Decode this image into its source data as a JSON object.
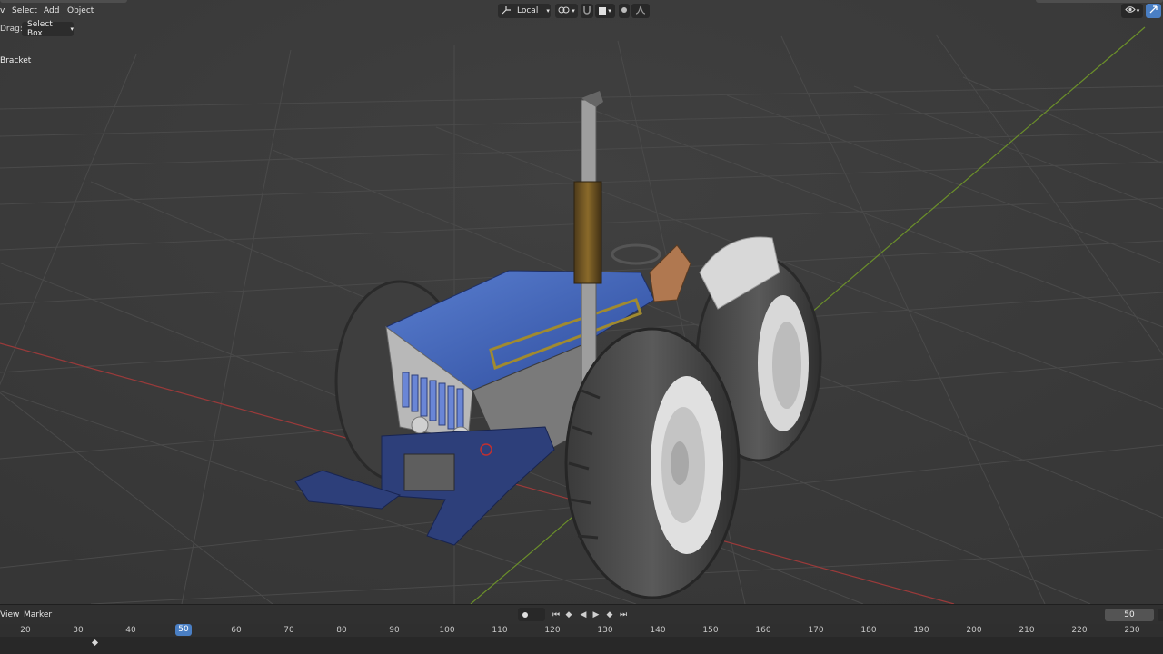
{
  "header": {
    "menu": [
      "Select",
      "Add",
      "Object"
    ],
    "transform_orientation": "Local",
    "colors": {
      "accent": "#4a7fc4",
      "viewport_bg": "#3a3a3a",
      "header_bg": "#2b2b2b"
    }
  },
  "tool_settings": {
    "drag_label": "Drag:",
    "drag_value": "Select Box"
  },
  "operator_panel": {
    "label": "Bracket"
  },
  "timeline": {
    "menu": [
      "View",
      "Marker"
    ],
    "current_frame": "50",
    "frame_field": "50",
    "ticks": [
      "20",
      "30",
      "40",
      "50",
      "60",
      "70",
      "80",
      "90",
      "100",
      "110",
      "120",
      "130",
      "140",
      "150",
      "160",
      "170",
      "180",
      "190",
      "200",
      "210",
      "220",
      "230"
    ],
    "keyframe_frames": [
      34
    ]
  },
  "icons": {
    "orientation": "axes-icon",
    "pivot": "pivot-icon",
    "snap": "snap-magnet-icon",
    "proportional": "proportional-edit-icon",
    "falloff": "falloff-curve-icon",
    "visibility": "eye-icon",
    "gizmo": "gizmo-icon"
  }
}
